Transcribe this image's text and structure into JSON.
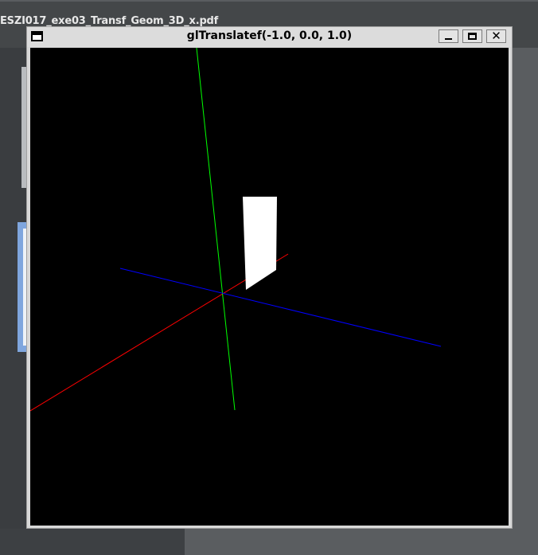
{
  "background": {
    "filename_text": "ESZI017_exe03_Transf_Geom_3D_x.pdf"
  },
  "window": {
    "title": "glTranslatef(-1.0, 0.0, 1.0)",
    "icon": "window-menu-icon",
    "buttons": {
      "minimize_icon": "minimize-icon",
      "maximize_icon": "maximize-icon",
      "close_label": "✕",
      "close_icon": "close-icon"
    }
  },
  "scene": {
    "background_color": "#000000",
    "axes": [
      {
        "name": "x-axis",
        "color": "#ff0000"
      },
      {
        "name": "y-axis",
        "color": "#00ff00"
      },
      {
        "name": "z-axis",
        "color": "#0000ff"
      }
    ],
    "object_color": "#ffffff"
  }
}
